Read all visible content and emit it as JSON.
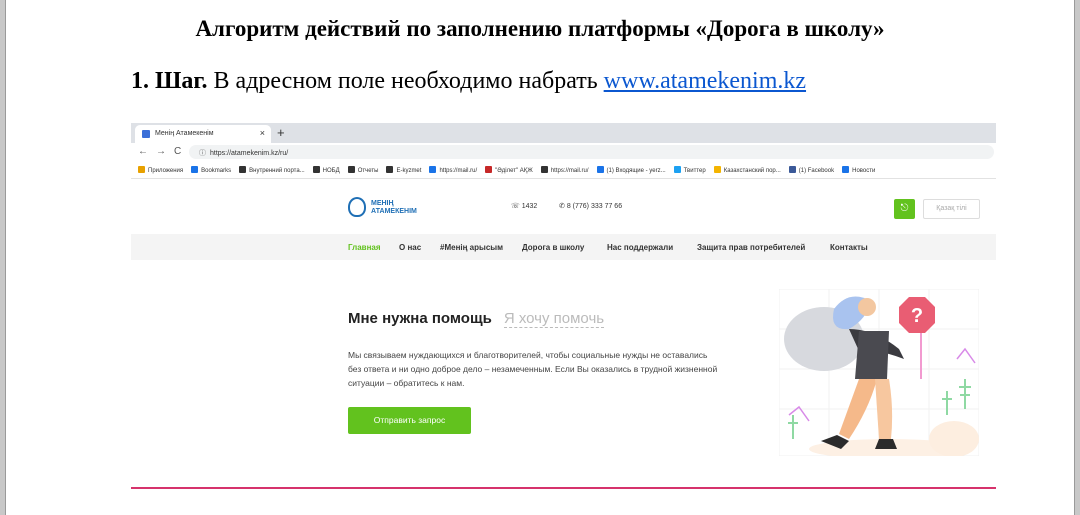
{
  "document": {
    "title": "Алгоритм действий по заполнению платформы «Дорога в школу»",
    "step_label": "1. Шаг.",
    "step_text": " В адресном поле необходимо набрать ",
    "step_link": "www.atamekenim.kz"
  },
  "browser": {
    "tab_title": "Менің Атамекенім",
    "tab_close": "×",
    "new_tab": "+",
    "nav_back": "←",
    "nav_forward": "→",
    "nav_reload": "C",
    "url": "https://atamekenim.kz/ru/",
    "bookmarks": [
      {
        "label": "Приложения",
        "color": "#e8a100"
      },
      {
        "label": "Bookmarks",
        "color": "#1a73e8"
      },
      {
        "label": "Внутренний порта...",
        "color": "#333333"
      },
      {
        "label": "НОБД",
        "color": "#333333"
      },
      {
        "label": "Отчеты",
        "color": "#333333"
      },
      {
        "label": "E-kyzmet",
        "color": "#333333"
      },
      {
        "label": "https://mail.ru/",
        "color": "#1a73e8"
      },
      {
        "label": "\"Әділет\" АҚЖ",
        "color": "#c62828"
      },
      {
        "label": "https://mail.ru/",
        "color": "#333333"
      },
      {
        "label": "(1) Входящие - yerz...",
        "color": "#1a73e8"
      },
      {
        "label": "Твиттер",
        "color": "#1da1f2"
      },
      {
        "label": "Казахстанский пор...",
        "color": "#f4b400"
      },
      {
        "label": "(1) Facebook",
        "color": "#3b5998"
      },
      {
        "label": "Новости",
        "color": "#1a73e8"
      }
    ]
  },
  "site": {
    "logo_line1": "МЕНІҢ",
    "logo_line2": "АТАМЕКЕНІМ",
    "phone_short": "1432",
    "phone_full": "8 (776) 333 77 66",
    "lang_button": "Қазақ тілі",
    "nav": [
      "Главная",
      "О нас",
      "#Менің арысым",
      "Дорога в школу",
      "Нас поддержали",
      "Защита прав потребителей",
      "Контакты"
    ],
    "hero_tab_active": "Мне нужна помощь",
    "hero_tab_inactive": "Я хочу помочь",
    "hero_text": "Мы связываем нуждающихся и благотворителей, чтобы социальные нужды не оставались без ответа и ни одно доброе дело – незамеченным. Если Вы оказались в трудной жизненной ситуации – обратитесь к нам.",
    "cta_label": "Отправить запрос"
  },
  "colors": {
    "accent_green": "#62c21e",
    "brand_blue": "#1f6fb5",
    "divider_pink": "#d6336c",
    "link_blue": "#0b57d0"
  }
}
